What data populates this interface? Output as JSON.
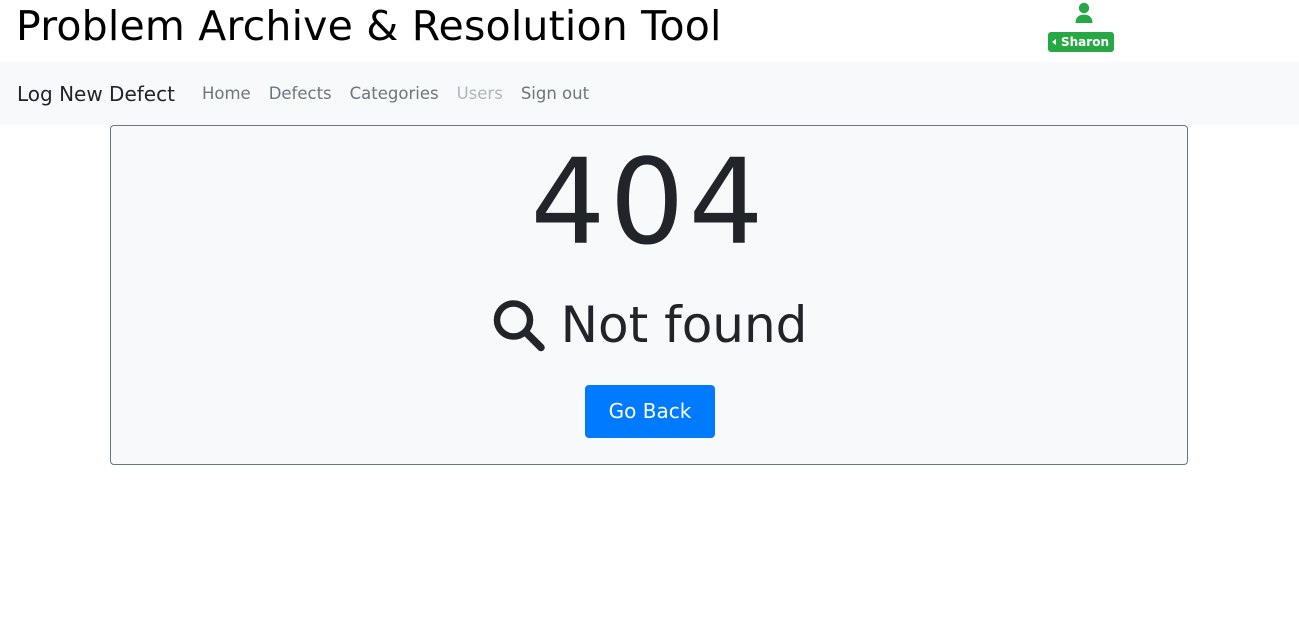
{
  "header": {
    "title": "Problem Archive & Resolution Tool",
    "user": {
      "icon": "user-icon",
      "name": "Sharon",
      "badge_color": "#28a745"
    }
  },
  "navbar": {
    "brand": "Log New Defect",
    "links": [
      {
        "label": "Home",
        "disabled": false
      },
      {
        "label": "Defects",
        "disabled": false
      },
      {
        "label": "Categories",
        "disabled": false
      },
      {
        "label": "Users",
        "disabled": true
      },
      {
        "label": "Sign out",
        "disabled": false
      }
    ]
  },
  "error": {
    "code": "404",
    "icon": "search-icon",
    "message": "Not found",
    "button_label": "Go Back",
    "button_color": "#007bff"
  }
}
